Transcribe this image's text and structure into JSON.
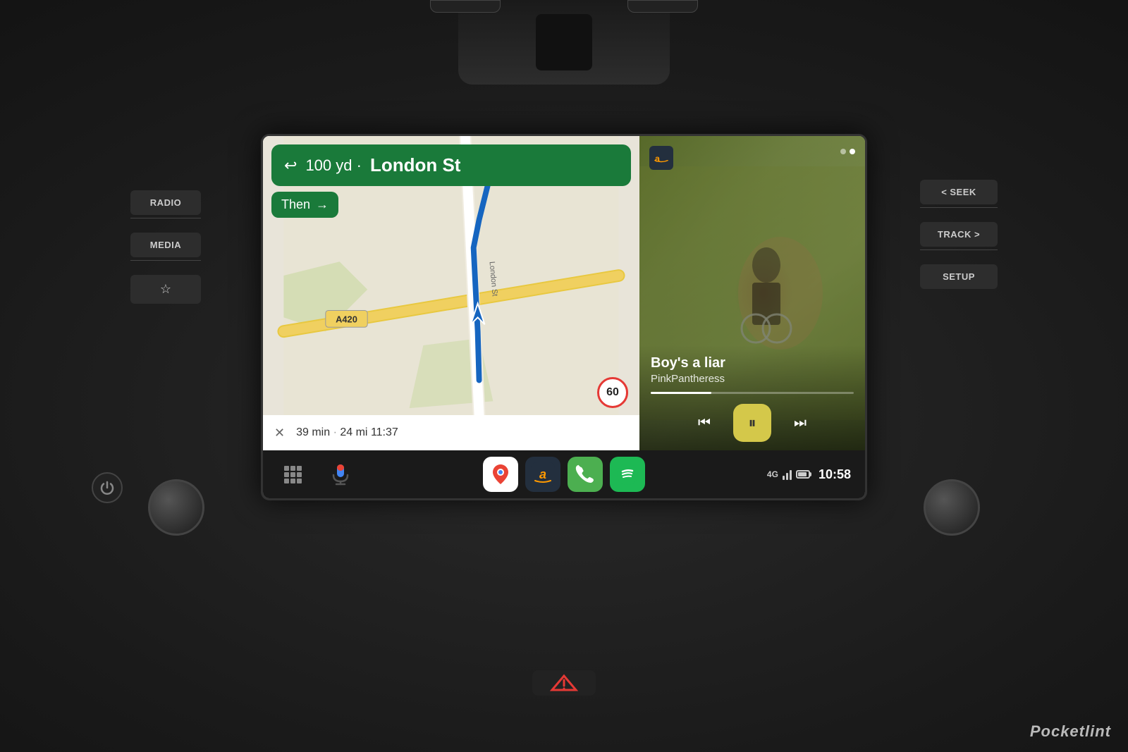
{
  "dashboard": {
    "left_buttons": {
      "radio_label": "RADIO",
      "media_label": "MEDIA",
      "star_icon": "☆"
    },
    "right_buttons": {
      "seek_label": "< SEEK",
      "track_label": "TRACK >",
      "setup_label": "SETUP"
    }
  },
  "navigation": {
    "direction_arrow": "↩",
    "distance": "100 yd",
    "dot": "·",
    "street_name": "London St",
    "then_label": "Then",
    "then_arrow": "→",
    "eta_time": "39 min",
    "distance_miles": "24 mi",
    "arrival_time": "11:37",
    "close_icon": "✕",
    "speed_limit": "60"
  },
  "music": {
    "song_title": "Boy's a liar",
    "artist_name": "PinkPantheress",
    "progress_percent": 30,
    "prev_icon": "⏮",
    "pause_icon": "⏸",
    "next_icon": "⏭",
    "dot1_active": false,
    "dot2_active": true
  },
  "bottom_nav": {
    "grid_icon": "⋮⋮⋮",
    "mic_icon": "🎤",
    "apps": [
      {
        "name": "Google Maps",
        "id": "maps"
      },
      {
        "name": "Amazon Music",
        "id": "amazon"
      },
      {
        "name": "Phone",
        "id": "phone"
      },
      {
        "name": "Spotify",
        "id": "spotify"
      }
    ],
    "signal_label": "4G",
    "time": "10:58"
  },
  "watermark": {
    "prefix": "P",
    "rest": "ocketlint"
  },
  "hazard": {
    "icon": "△"
  }
}
